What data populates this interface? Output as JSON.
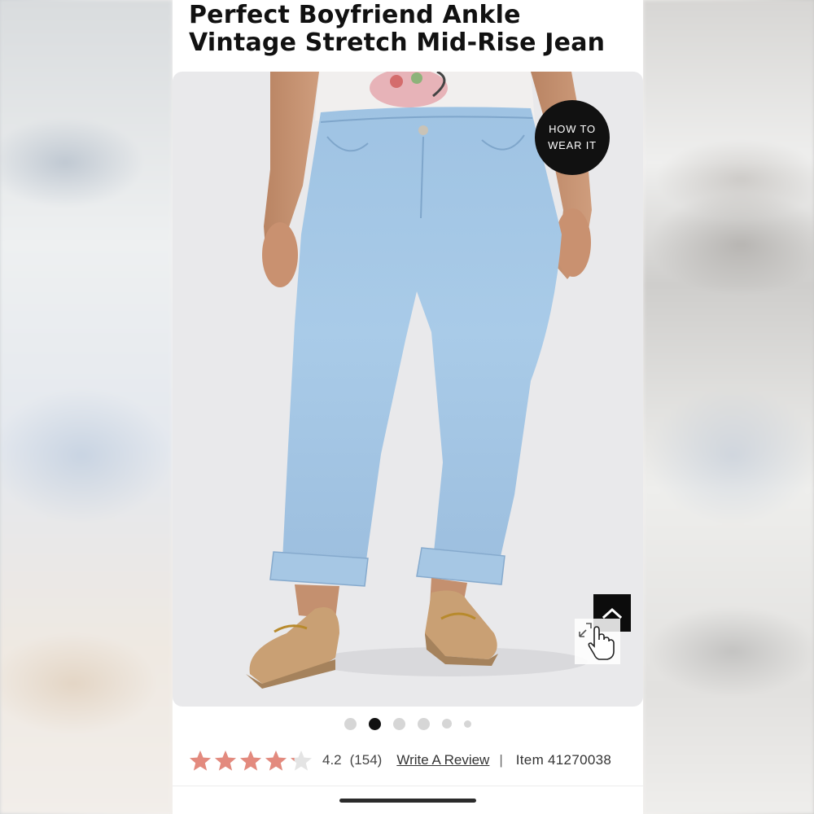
{
  "product": {
    "title_line1": "Perfect Boyfriend Ankle",
    "title_line2": "Vintage Stretch Mid-Rise Jean"
  },
  "image_overlay": {
    "how_to_line1": "HOW TO",
    "how_to_line2": "WEAR IT"
  },
  "carousel": {
    "slide_count": 6,
    "active_index": 1
  },
  "rating": {
    "value": "4.2",
    "count": "(154)",
    "stars_filled": 4.2,
    "star_color": "#e38a7e",
    "write_review_label": "Write A Review",
    "separator": "|",
    "item_label": "Item 41270038"
  },
  "icons": [
    "chevron-up-icon",
    "expand-arrows-icon",
    "hand-pointer-icon",
    "star-icon"
  ]
}
